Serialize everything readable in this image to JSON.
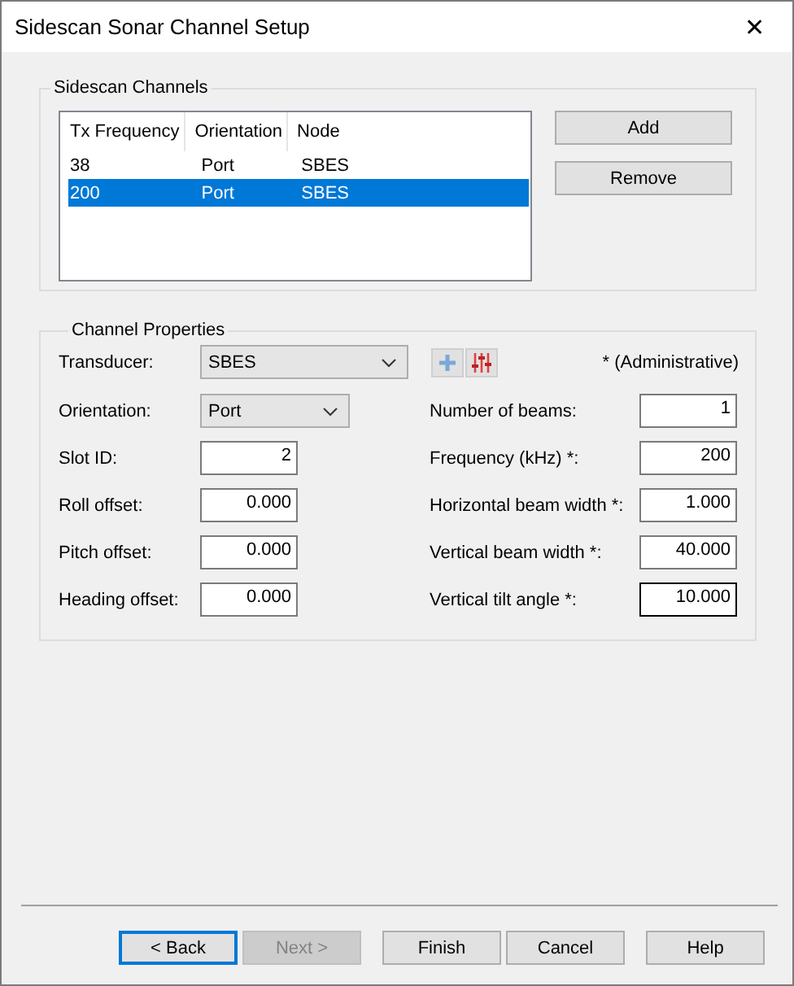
{
  "window": {
    "title": "Sidescan Sonar Channel Setup",
    "close": "✕"
  },
  "channels": {
    "title": "Sidescan Channels",
    "columns": [
      "Tx Frequency",
      "Orientation",
      "Node"
    ],
    "rows": [
      {
        "cells": [
          "38",
          "Port",
          "SBES"
        ],
        "selected": false
      },
      {
        "cells": [
          "200",
          "Port",
          "SBES"
        ],
        "selected": true
      }
    ],
    "buttons": [
      "Add",
      "Remove"
    ]
  },
  "properties": {
    "title": "Channel Properties",
    "transducer": {
      "label": "Transducer:",
      "value": "SBES"
    },
    "note": "* (Administrative)",
    "left": [
      {
        "label": "Orientation:",
        "value": "Port",
        "kind": "combo"
      },
      {
        "label": "Slot ID:",
        "value": "2",
        "kind": "field"
      },
      {
        "label": "Roll offset:",
        "value": "0.000",
        "kind": "field"
      },
      {
        "label": "Pitch offset:",
        "value": "0.000",
        "kind": "field"
      },
      {
        "label": "Heading offset:",
        "value": "0.000",
        "kind": "field"
      }
    ],
    "right": [
      {
        "label": "Number of beams:",
        "value": "1",
        "focused": false
      },
      {
        "label": "Frequency (kHz) *:",
        "value": "200",
        "focused": false
      },
      {
        "label": "Horizontal beam width *:",
        "value": "1.000",
        "focused": false
      },
      {
        "label": "Vertical beam width *:",
        "value": "40.000",
        "focused": false
      },
      {
        "label": "Vertical tilt angle *:",
        "value": "10.000",
        "focused": true
      }
    ]
  },
  "buttons": [
    {
      "label": "< Back",
      "disabled": false,
      "focused": true
    },
    {
      "label": "Next >",
      "disabled": true,
      "focused": false
    },
    {
      "label": "Finish",
      "disabled": false,
      "focused": false
    },
    {
      "label": "Cancel",
      "disabled": false,
      "focused": false
    },
    {
      "label": "Help",
      "disabled": false,
      "focused": false
    }
  ]
}
